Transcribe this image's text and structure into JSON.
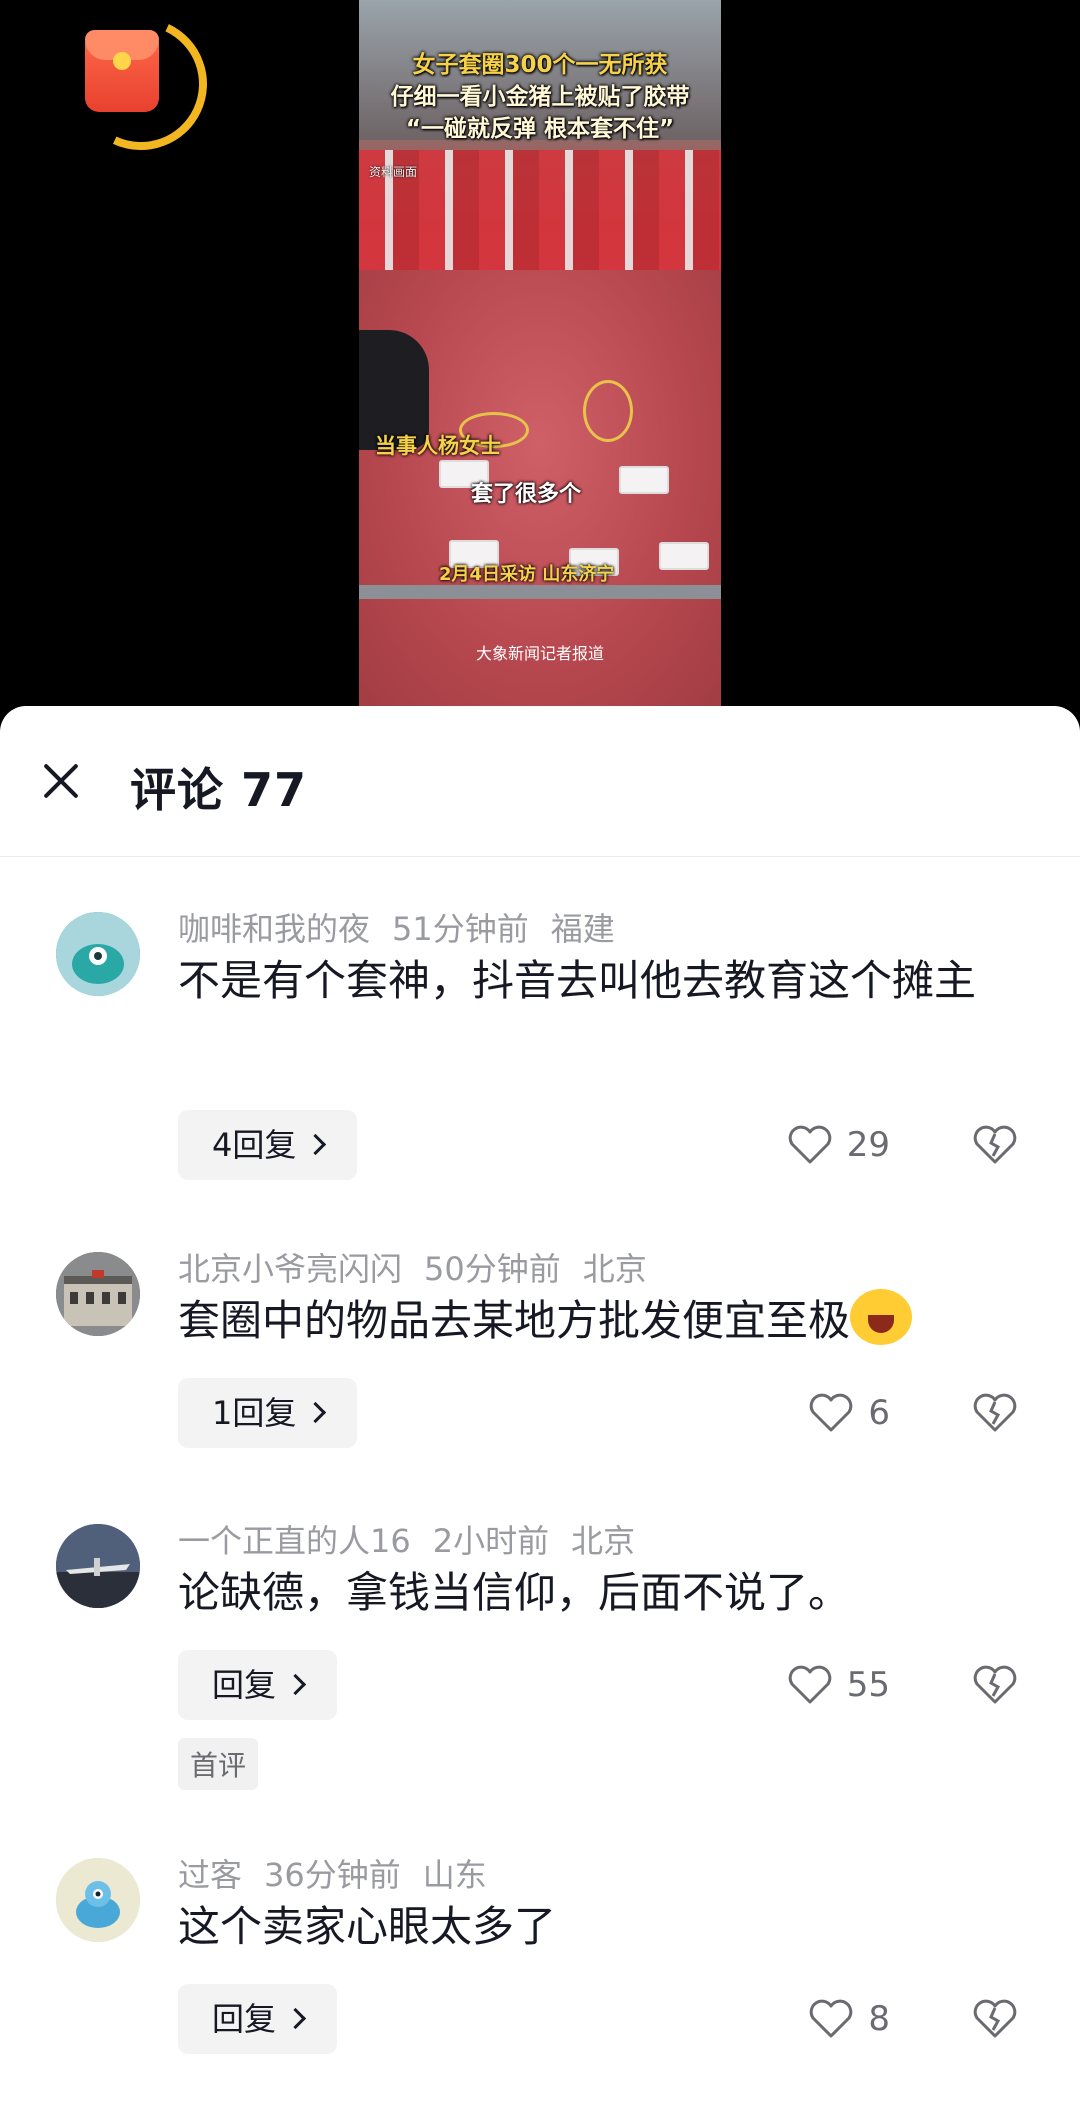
{
  "video": {
    "caption_line1": "女子套圈300个一无所获",
    "caption_line2": "仔细一看小金猪上被贴了胶带",
    "caption_line3": "“一碰就反弹 根本套不住”",
    "small_tag": "资料画面",
    "label_person": "当事人杨女士",
    "subtitle": "套了很多个",
    "date_location": "2月4日采访 山东济宁",
    "footer": "大象新闻记者报道"
  },
  "sheet": {
    "title": "评论 77"
  },
  "comments": [
    {
      "username": "咖啡和我的夜",
      "time": "51分钟前",
      "location": "福建",
      "text": "不是有个套神，抖音去叫他去教育这个摊主",
      "reply_label": "4回复",
      "likes": "29",
      "avatar_color": "#4bb3b5"
    },
    {
      "username": "北京小爷亮闪闪",
      "time": "50分钟前",
      "location": "北京",
      "text": "套圈中的物品去某地方批发便宜至极",
      "reply_label": "1回复",
      "likes": "6",
      "avatar_color": "#6d6a66",
      "emoji": "crying-laughing-face"
    },
    {
      "username": "一个正直的人16",
      "time": "2小时前",
      "location": "北京",
      "text": "论缺德，拿钱当信仰，后面不说了。",
      "reply_label": "回复",
      "likes": "55",
      "badge": "首评",
      "avatar_color": "#3b4a5c"
    },
    {
      "username": "过客",
      "time": "36分钟前",
      "location": "山东",
      "text": "这个卖家心眼太多了",
      "reply_label": "回复",
      "likes": "8",
      "avatar_color": "#d9d8c9"
    }
  ],
  "colors": {
    "text_primary": "#161823",
    "text_meta": "#9a9ba0",
    "accent_gold": "#f2b620",
    "redpacket": "#e8412f"
  }
}
